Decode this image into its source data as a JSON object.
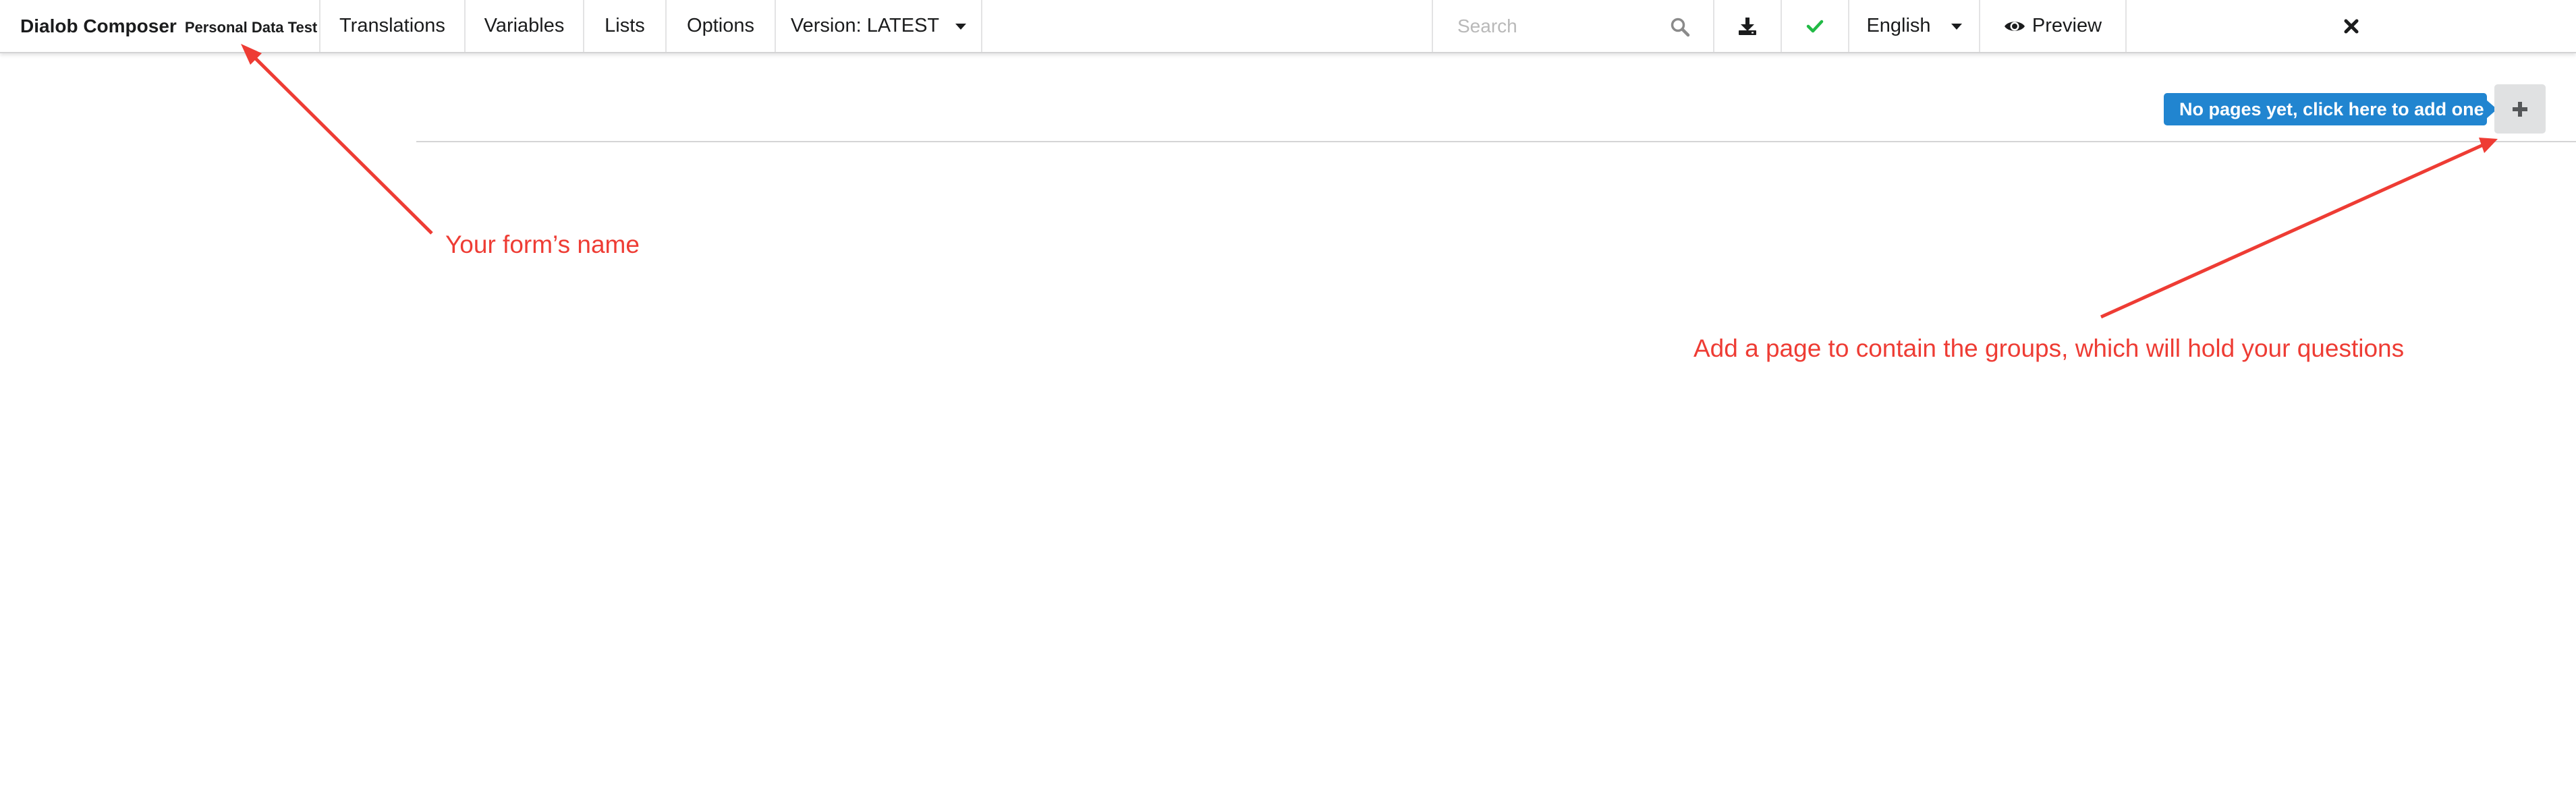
{
  "menubar": {
    "app_title": "Dialob Composer",
    "form_name": "Personal Data Test",
    "items": [
      {
        "label": "Translations"
      },
      {
        "label": "Variables"
      },
      {
        "label": "Lists"
      },
      {
        "label": "Options"
      }
    ],
    "version_label": "Version: LATEST",
    "search": {
      "placeholder": "Search",
      "value": ""
    },
    "language": "English",
    "preview_label": "Preview",
    "icons": {
      "search": "search-icon",
      "download": "download-icon",
      "validate": "check-icon",
      "preview": "eye-icon",
      "close": "close-icon",
      "add": "plus-icon"
    }
  },
  "pages": {
    "empty_tooltip": "No pages yet, click here to add one"
  },
  "annotations": {
    "form_name": "Your form’s name",
    "add_page": "Add a page to contain the groups, which will hold your questions"
  },
  "colors": {
    "accent_blue": "#2185d0",
    "annotation_red": "#ee3c34",
    "check_green": "#21ba45",
    "button_grey": "#e0e1e2"
  }
}
